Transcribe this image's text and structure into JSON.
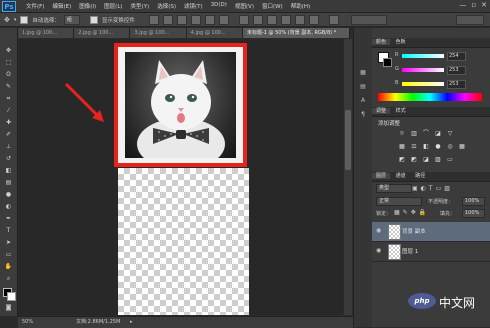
{
  "app": {
    "logo": "Ps"
  },
  "menu": [
    "文件(F)",
    "编辑(E)",
    "图像(I)",
    "图层(L)",
    "类型(Y)",
    "选择(S)",
    "滤镜(T)",
    "3D(D)",
    "视图(V)",
    "窗口(W)",
    "帮助(H)"
  ],
  "window_controls": [
    "—",
    "▫",
    "✕"
  ],
  "options": {
    "auto_select_label": "自动选择：",
    "auto_select_value": "组",
    "transform_label": "显示变换控件"
  },
  "tabs": [
    {
      "label": "1.jpg @ 100...",
      "active": false
    },
    {
      "label": "2.jpg @ 100...",
      "active": false
    },
    {
      "label": "3.jpg @ 100...",
      "active": false
    },
    {
      "label": "4.jpg @ 100...",
      "active": false
    },
    {
      "label": "未标题-1 @ 50% (背景 副本, RGB/8) *",
      "active": true
    }
  ],
  "status": {
    "zoom": "50%",
    "doc": "文档:2.86M/1.25M"
  },
  "color_panel": {
    "tabs": [
      "颜色",
      "色板"
    ],
    "r": "254",
    "g": "253",
    "b": "253"
  },
  "adjustments_panel": {
    "tabs": [
      "调整",
      "样式"
    ],
    "label": "添加调整"
  },
  "layers_panel": {
    "tabs": [
      "图层",
      "通道",
      "路径"
    ],
    "kind_label": "类型",
    "blend_mode": "正常",
    "opacity_label": "不透明度：",
    "opacity_value": "100%",
    "lock_label": "锁定：",
    "fill_label": "填充：",
    "fill_value": "100%",
    "layers": [
      {
        "name": "背景 副本",
        "selected": true
      },
      {
        "name": "图层 1",
        "selected": false
      }
    ]
  },
  "watermark": {
    "badge": "php",
    "text": "中文网"
  },
  "colors": {
    "accent_red": "#e8231c",
    "ps_blue": "#48a8ee",
    "selected_layer": "#5d6b7d"
  }
}
